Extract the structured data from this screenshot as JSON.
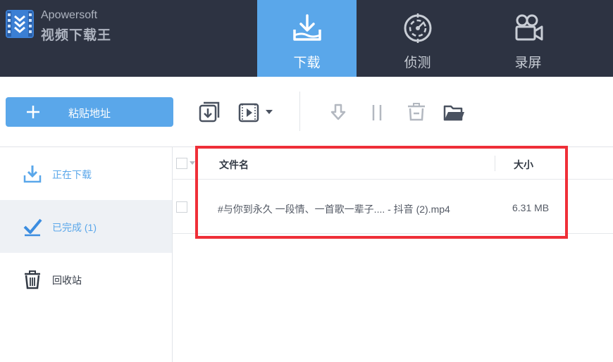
{
  "brand": {
    "name_en": "Apowersoft",
    "name_cn": "视频下载王"
  },
  "nav_tabs": [
    {
      "label": "下载",
      "icon": "download-tray-icon",
      "active": true
    },
    {
      "label": "侦测",
      "icon": "radar-icon",
      "active": false
    },
    {
      "label": "录屏",
      "icon": "video-camera-icon",
      "active": false
    }
  ],
  "toolbar": {
    "paste_label": "粘贴地址",
    "tools": [
      "download-to-box-icon",
      "video-file-icon",
      "dropdown-arrow-icon",
      "download-arrow-icon",
      "pause-icon",
      "trash-icon",
      "open-folder-icon"
    ]
  },
  "sidebar": {
    "items": [
      {
        "label": "正在下载",
        "icon": "downloading-icon"
      },
      {
        "label": "已完成 (1)",
        "icon": "checkmark-icon"
      },
      {
        "label": "回收站",
        "icon": "recycle-bin-icon"
      }
    ]
  },
  "table": {
    "headers": {
      "name": "文件名",
      "size": "大小"
    },
    "rows": [
      {
        "name": "#与你到永久 一段情、一首歌一辈子.... - 抖音 (2).mp4",
        "size": "6.31 MB"
      }
    ]
  },
  "colors": {
    "header_bg": "#2d3342",
    "accent": "#5aa7ea",
    "highlight": "#ef2f38",
    "selected_row_bg": "#eef1f5"
  }
}
